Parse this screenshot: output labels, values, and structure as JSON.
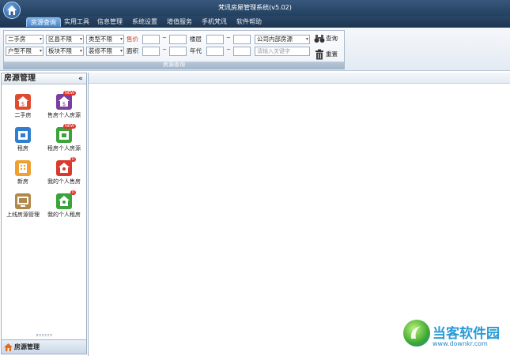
{
  "window": {
    "title": "梵讯房屋管理系统(v5.02)"
  },
  "menu": {
    "items": [
      "房源查询",
      "实用工具",
      "信息管理",
      "系统设置",
      "增值服务",
      "手机梵讯",
      "软件帮助"
    ],
    "active": "房源查询"
  },
  "filters": {
    "row1": {
      "type": "二手房",
      "district": "区县不限",
      "category": "类型不限",
      "price_label": "售价",
      "floor_label": "楼层",
      "scope": "公司内部房源"
    },
    "row2": {
      "layout": "户型不限",
      "area_block": "板块不限",
      "decoration": "装修不限",
      "size_label": "面积",
      "year_label": "年代",
      "keyword_placeholder": "请输入关键字"
    },
    "query_label": "查询",
    "reset_label": "重置",
    "caption": "房源查询",
    "tilde": "~"
  },
  "sidebar": {
    "title": "房源管理",
    "collapse": "«",
    "tiles": [
      {
        "label": "二手房",
        "icon": "house-sale-icon",
        "color": "#e04a2e"
      },
      {
        "label": "售房个人房源",
        "icon": "personal-sale-icon",
        "color": "#7a3fa0",
        "badge": "NEW"
      },
      {
        "label": "租房",
        "icon": "rent-icon",
        "color": "#2f7ed0"
      },
      {
        "label": "租房个人房源",
        "icon": "personal-rent-icon",
        "color": "#3aa33a",
        "badge": "NEW"
      },
      {
        "label": "新房",
        "icon": "new-house-icon",
        "color": "#f0a030"
      },
      {
        "label": "我的个人售房",
        "icon": "my-sale-icon",
        "color": "#d83a2e",
        "badge": "0"
      },
      {
        "label": "上线房源管理",
        "icon": "online-listing-icon",
        "color": "#b0884a"
      },
      {
        "label": "我的个人租房",
        "icon": "my-rent-icon",
        "color": "#3aa33a",
        "badge": "0"
      }
    ],
    "footer": "房源管理"
  },
  "watermark": {
    "name": "当客软件园",
    "url": "www.downkr.com"
  }
}
